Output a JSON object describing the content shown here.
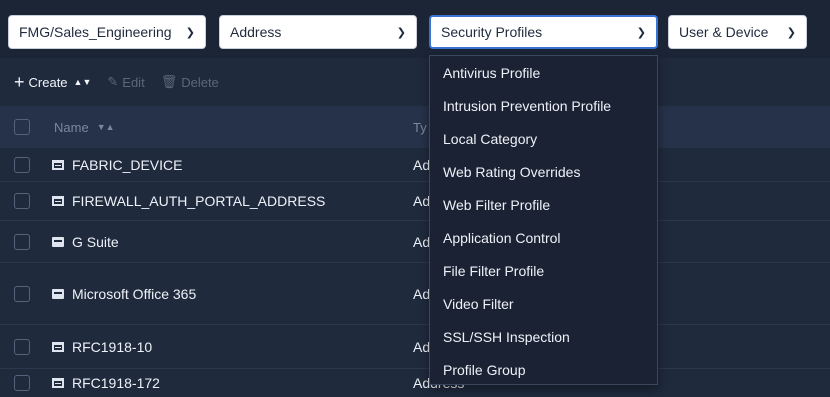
{
  "filters": {
    "adom": "FMG/Sales_Engineering",
    "address": "Address",
    "security": "Security Profiles",
    "user": "User & Device"
  },
  "toolbar": {
    "create": "Create",
    "edit": "Edit",
    "delete": "Delete"
  },
  "table": {
    "col_name": "Name",
    "col_type": "Ty",
    "rows": [
      {
        "name": "FABRIC_DEVICE",
        "type": "Ad",
        "icon": "address-icon"
      },
      {
        "name": "FIREWALL_AUTH_PORTAL_ADDRESS",
        "type": "Ad",
        "icon": "address-icon"
      },
      {
        "name": "G Suite",
        "type": "Ad",
        "icon": "fqdn-icon"
      },
      {
        "name": "Microsoft Office 365",
        "type": "Ad",
        "icon": "fqdn-icon"
      },
      {
        "name": "RFC1918-10",
        "type": "Ad",
        "icon": "address-icon"
      },
      {
        "name": "RFC1918-172",
        "type": "Address",
        "icon": "address-icon"
      }
    ]
  },
  "dropdown": {
    "items": [
      "Antivirus Profile",
      "Intrusion Prevention Profile",
      "Local Category",
      "Web Rating Overrides",
      "Web Filter Profile",
      "Application Control",
      "File Filter Profile",
      "Video Filter",
      "SSL/SSH Inspection",
      "Profile Group"
    ]
  }
}
